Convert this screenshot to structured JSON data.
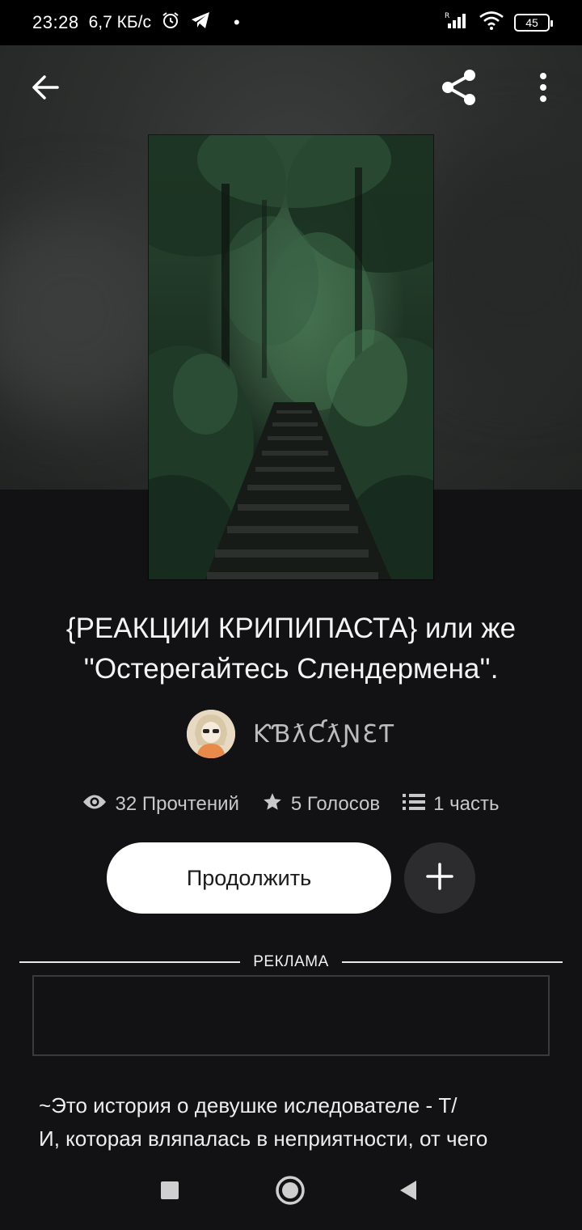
{
  "status_bar": {
    "time": "23:28",
    "network_speed": "6,7 КБ/с",
    "battery": "45"
  },
  "story": {
    "title": "{РЕАКЦИИ КРИПИПАСТА} или же ''Остерегайтесь Слендермена''.",
    "author": "ƘƁƛƇƛƝƐƬ",
    "stats": {
      "reads": "32 Прочтений",
      "votes": "5 Голосов",
      "parts": "1 часть"
    }
  },
  "actions": {
    "continue_label": "Продолжить"
  },
  "ad": {
    "label": "РЕКЛАМА"
  },
  "description": {
    "line1": "~Это история о девушке иcледователе - Т/",
    "line2": "И, которая вляпалась в неприятности, от чего"
  },
  "icons": {
    "back": "arrow-left-icon",
    "share": "share-icon",
    "more": "more-vertical-icon",
    "reads": "eye-icon",
    "votes": "star-icon",
    "parts": "list-icon",
    "add": "plus-icon"
  },
  "colors": {
    "background": "#121113",
    "button_primary": "#ffffff",
    "button_secondary": "#2c2b2e"
  }
}
